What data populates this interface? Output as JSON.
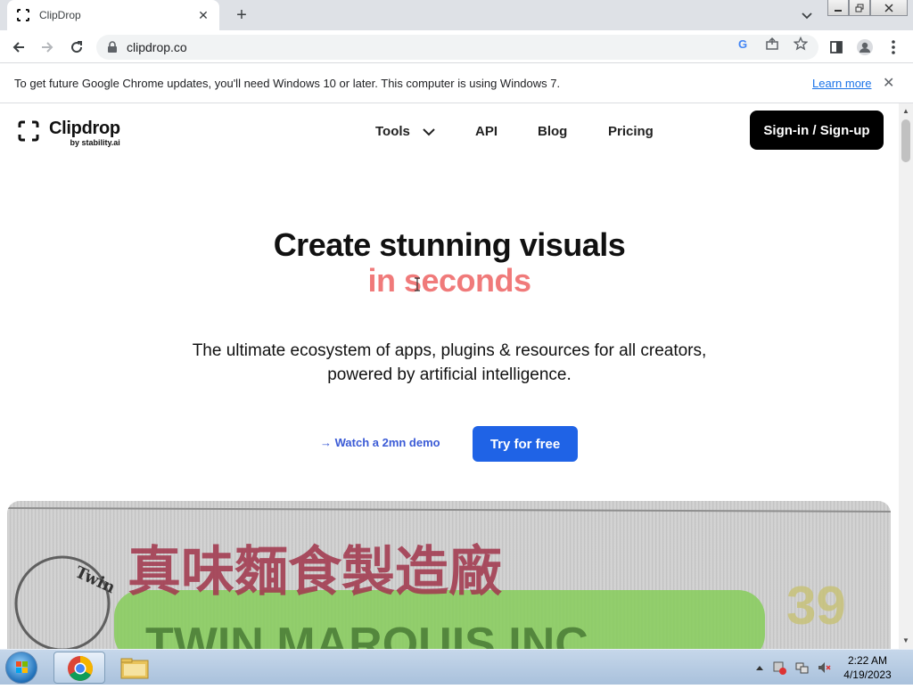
{
  "browser": {
    "tab_title": "ClipDrop",
    "tab_close": "✕",
    "new_tab": "+",
    "url": "clipdrop.co"
  },
  "infobar": {
    "message": "To get future Google Chrome updates, you'll need Windows 10 or later. This computer is using Windows 7.",
    "learn_more": "Learn more",
    "close": "✕"
  },
  "site": {
    "logo_name": "Clipdrop",
    "logo_by": "by stability.ai",
    "nav": {
      "tools": "Tools",
      "api": "API",
      "blog": "Blog",
      "pricing": "Pricing"
    },
    "signin": "Sign-in / Sign-up"
  },
  "hero": {
    "line1": "Create stunning visuals",
    "line2": "in seconds",
    "subtitle_line1": "The ultimate ecosystem of apps, plugins & resources for all creators,",
    "subtitle_line2": "powered by artificial intelligence.",
    "demo_link": "→ Watch a 2mn demo",
    "try_button": "Try for free",
    "image_sign_chinese": "真味麵食製造廠",
    "image_sign_english": "TWIN MARQUIS INC",
    "image_sign_number": "39",
    "image_stamp_text": "Twin"
  },
  "taskbar": {
    "time": "2:22 AM",
    "date": "4/19/2023"
  },
  "colors": {
    "accent_pink": "#f07a7a",
    "primary_blue": "#1f63e6",
    "link_blue": "#3b5bd6"
  }
}
